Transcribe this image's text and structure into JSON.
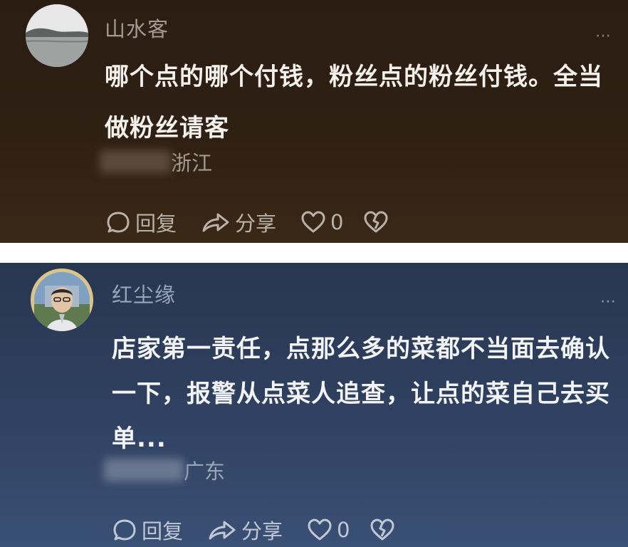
{
  "comments": [
    {
      "username": "山水客",
      "text": "哪个点的哪个付钱，粉丝点的粉丝付钱。全当做粉丝请客",
      "location": "浙江",
      "more_icon": "⋯",
      "actions": {
        "reply_label": "回复",
        "share_label": "分享",
        "like_count": "0"
      },
      "theme": {
        "background": "#2f2014"
      }
    },
    {
      "username": "红尘缘",
      "text": "店家第一责任，点那么多的菜都不当面去确认一下，报警从点菜人追查，让点的菜自己去买单...",
      "location": "广东",
      "more_icon": "⋯",
      "actions": {
        "reply_label": "回复",
        "share_label": "分享",
        "like_count": "0"
      },
      "theme": {
        "background": "#2f4060"
      }
    }
  ],
  "icons": {
    "reply": "reply-bubble-icon",
    "share": "share-arrow-icon",
    "like": "heart-icon",
    "dislike": "broken-heart-icon",
    "more": "more-dots-icon"
  }
}
